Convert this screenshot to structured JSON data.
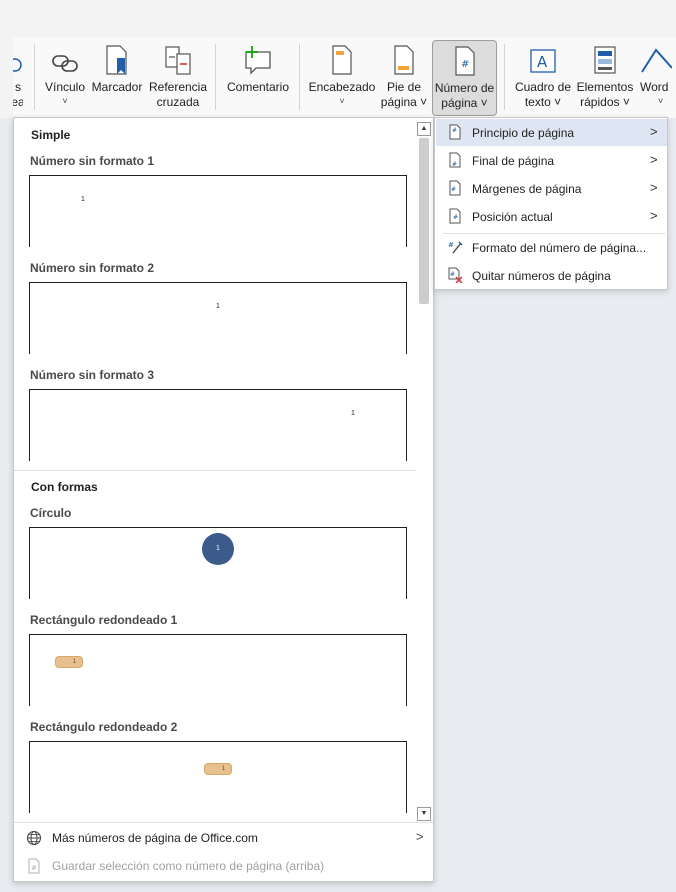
{
  "ribbon": {
    "partial_left": {
      "line1": "s",
      "line2": "ea"
    },
    "buttons": [
      {
        "line1": "Vínculo",
        "line2": "˅",
        "icon": "link-icon"
      },
      {
        "line1": "Marcador",
        "line2": "",
        "icon": "bookmark-icon"
      },
      {
        "line1": "Referencia",
        "line2": "cruzada",
        "icon": "cross-reference-icon"
      },
      {
        "line1": "Comentario",
        "line2": "",
        "icon": "comment-icon"
      },
      {
        "line1": "Encabezado",
        "line2": "˅",
        "icon": "header-icon"
      },
      {
        "line1": "Pie de",
        "line2": "página ˅",
        "icon": "footer-icon"
      },
      {
        "line1": "Número de",
        "line2": "página ˅",
        "icon": "page-number-icon"
      },
      {
        "line1": "Cuadro de",
        "line2": "texto ˅",
        "icon": "text-box-icon"
      },
      {
        "line1": "Elementos",
        "line2": "rápidos ˅",
        "icon": "quick-parts-icon"
      },
      {
        "line1": "Word",
        "line2": "˅",
        "icon": "wordart-icon"
      }
    ]
  },
  "gallery": {
    "sections": [
      {
        "title": "Simple",
        "items": [
          {
            "title": "Número sin formato 1",
            "number": "1"
          },
          {
            "title": "Número sin formato 2",
            "number": "1"
          },
          {
            "title": "Número sin formato 3",
            "number": "1"
          }
        ]
      },
      {
        "title": "Con formas",
        "items": [
          {
            "title": "Círculo",
            "number": "1"
          },
          {
            "title": "Rectángulo redondeado 1",
            "number": "1"
          },
          {
            "title": "Rectángulo redondeado 2",
            "number": "1"
          }
        ]
      }
    ],
    "footer": {
      "more": "Más números de página de Office.com",
      "save": "Guardar selección como número de página (arriba)"
    }
  },
  "submenu": {
    "items": [
      {
        "label": "Principio de página",
        "has_arrow": true
      },
      {
        "label": "Final de página",
        "has_arrow": true
      },
      {
        "label": "Márgenes de página",
        "has_arrow": true
      },
      {
        "label": "Posición actual",
        "has_arrow": true
      },
      {
        "label": "Formato del número de página...",
        "has_arrow": false
      },
      {
        "label": "Quitar números de página",
        "has_arrow": false
      }
    ]
  },
  "colors": {
    "accent": "#3b5b8a",
    "highlight": "#dfe6f3",
    "shape_fill": "#e6c08f",
    "icon_blue": "#1f5fa8",
    "icon_orange": "#f2a33a"
  }
}
